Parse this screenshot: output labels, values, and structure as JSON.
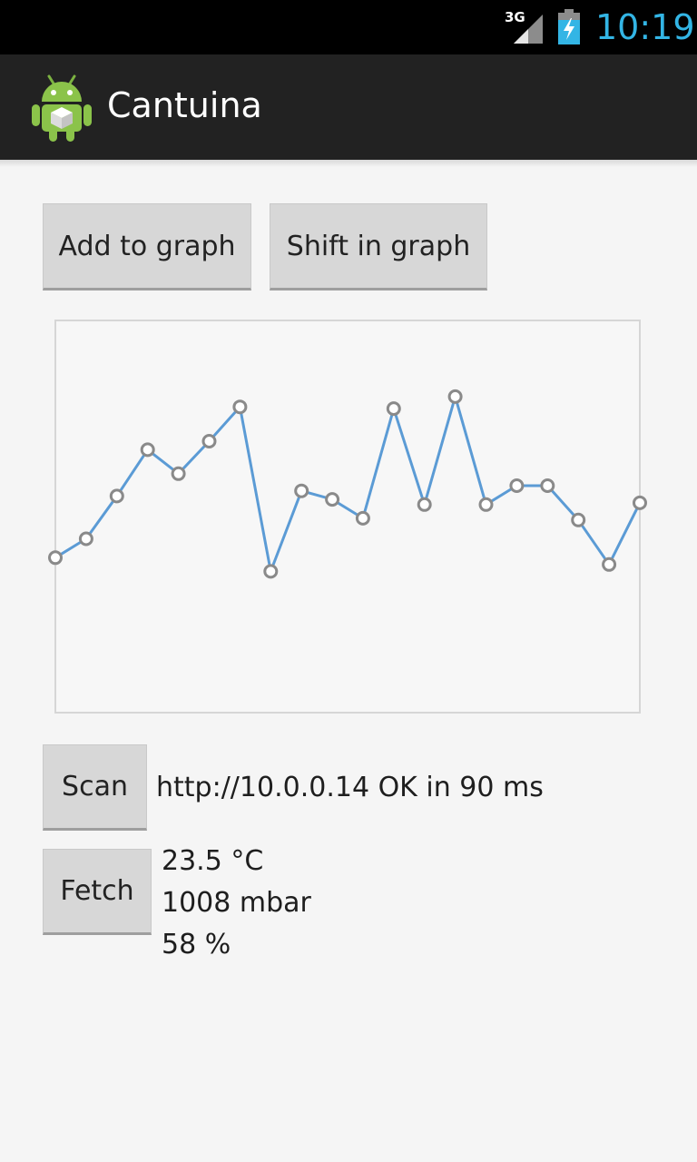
{
  "status_bar": {
    "network": "3G",
    "time": "10:19",
    "icons": [
      "signal-icon",
      "battery-charging-icon"
    ]
  },
  "action_bar": {
    "title": "Cantuina",
    "icon": "android-app-icon"
  },
  "buttons": {
    "add_to_graph": "Add to graph",
    "shift_in_graph": "Shift in graph",
    "scan": "Scan",
    "fetch": "Fetch"
  },
  "scan": {
    "result": "http://10.0.0.14 OK in 90 ms"
  },
  "readings": {
    "temperature": "23.5 °C",
    "pressure": "1008 mbar",
    "humidity": "58 %"
  },
  "colors": {
    "accent": "#33b5e5",
    "graph_line": "#5b9bd5",
    "marker": "#8a8a8a"
  },
  "chart_data": {
    "type": "line",
    "x": [
      0,
      1,
      2,
      3,
      4,
      5,
      6,
      7,
      8,
      9,
      10,
      11,
      12,
      13,
      14,
      15,
      16,
      17,
      18,
      19
    ],
    "values": [
      6.1,
      7.2,
      9.7,
      12.4,
      11.0,
      12.9,
      14.9,
      5.3,
      10.0,
      9.5,
      8.4,
      14.8,
      9.2,
      15.5,
      9.2,
      10.3,
      10.3,
      8.3,
      5.7,
      9.3
    ],
    "ylim": [
      -3,
      20
    ],
    "grid": false
  }
}
